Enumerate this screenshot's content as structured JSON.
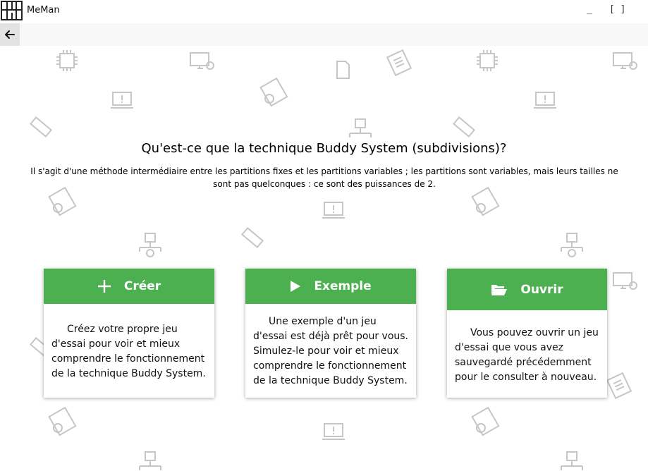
{
  "window": {
    "title": "MeMan",
    "minimize_label": "_",
    "maximize_label": "[ ]"
  },
  "page": {
    "heading": "Qu'est-ce que la technique Buddy System (subdivisions)?",
    "description": "Il s'agit d'une méthode intermédiaire entre les partitions fixes et les partitions variables ; les partitions sont variables, mais leurs tailles ne sont pas quelconques : ce sont des puissances de 2."
  },
  "cards": {
    "create": {
      "title": "Créer",
      "icon": "plus-icon",
      "text": "Créez votre propre jeu d'essai pour voir et mieux comprendre le fonctionnement de la technique Buddy System."
    },
    "example": {
      "title": "Exemple",
      "icon": "play-icon",
      "text": "Une exemple d'un jeu d'essai est déjà prêt pour vous. Simulez-le pour voir et mieux comprendre le fonctionnement de la technique Buddy System."
    },
    "open": {
      "title": "Ouvrir",
      "icon": "folder-open-icon",
      "text": "Vous pouvez ouvrir un jeu d'essai que vous avez sauvegardé précédemment pour le consulter à nouveau."
    }
  },
  "colors": {
    "accent": "#4caf50",
    "background": "#ffffff",
    "navbar": "#f8f8f8",
    "back_button": "#e3e3e3"
  }
}
